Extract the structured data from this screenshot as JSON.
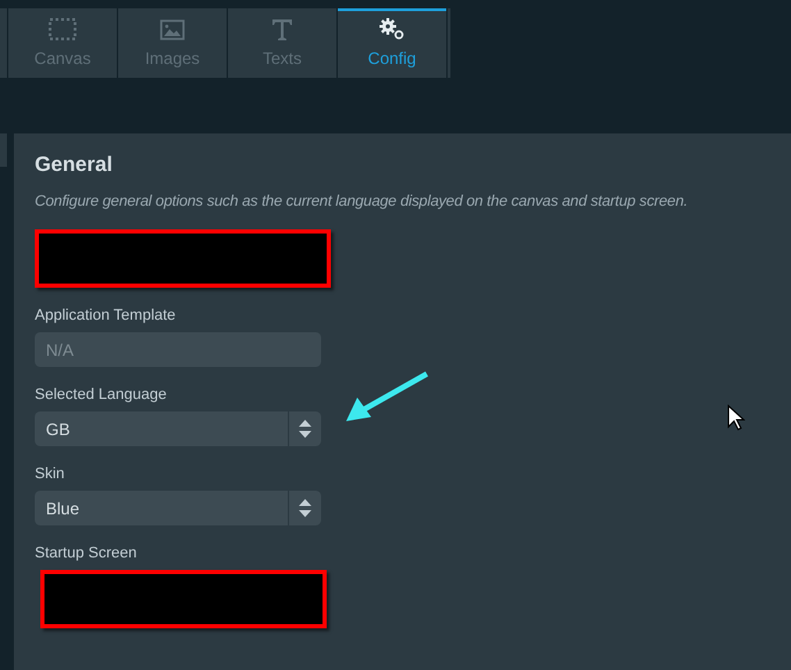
{
  "tabs": [
    {
      "label": "Canvas",
      "kind": "canvas",
      "selected": false
    },
    {
      "label": "Images",
      "kind": "images",
      "selected": false
    },
    {
      "label": "Texts",
      "kind": "texts",
      "selected": false
    },
    {
      "label": "Config",
      "kind": "config",
      "selected": true
    }
  ],
  "section": {
    "title": "General",
    "description": "Configure general options such as the current language displayed on the canvas and startup screen."
  },
  "fields": [
    {
      "kind": "redacted"
    },
    {
      "kind": "text",
      "label": "Application Template",
      "value": "N/A"
    },
    {
      "kind": "select",
      "label": "Selected Language",
      "value": "GB",
      "annotated": true
    },
    {
      "kind": "select",
      "label": "Skin",
      "value": "Blue"
    },
    {
      "kind": "redacted",
      "label": "Startup Screen"
    }
  ]
}
